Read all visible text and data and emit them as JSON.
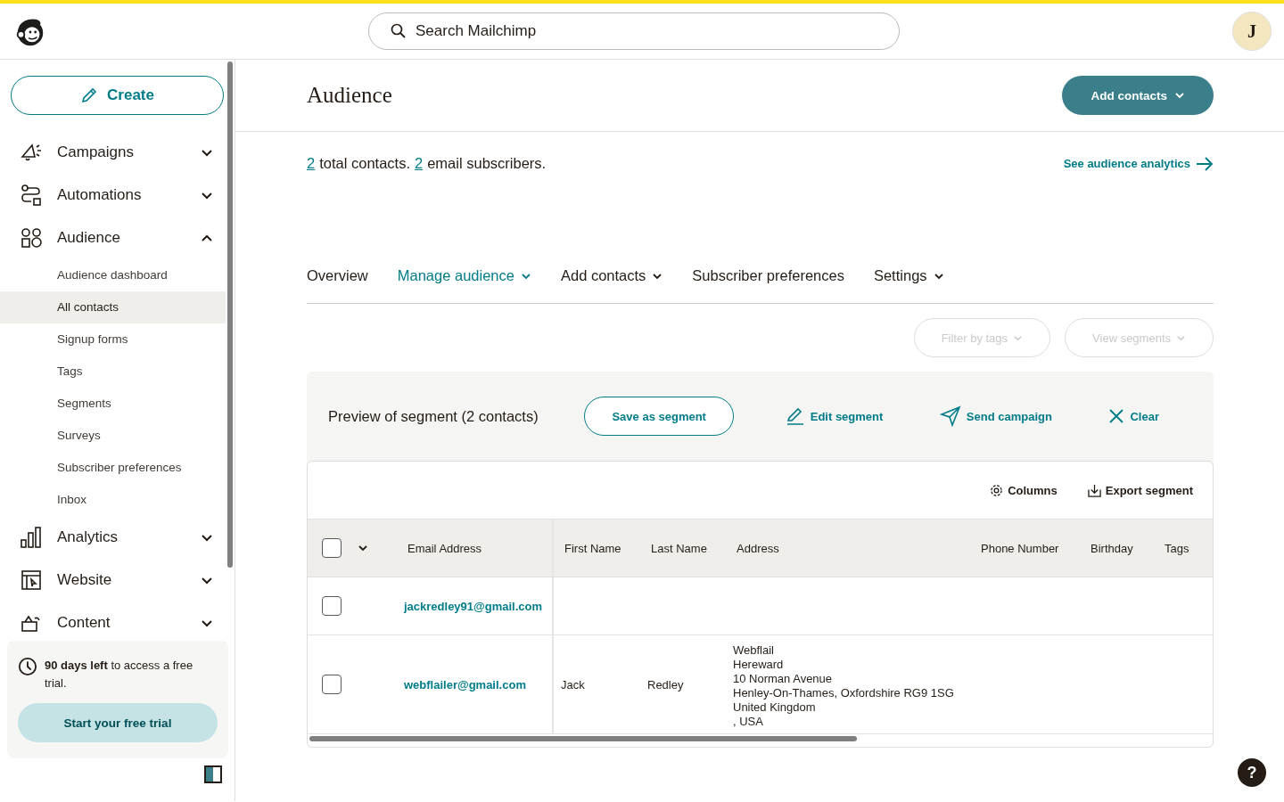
{
  "header": {
    "search_placeholder": "Search Mailchimp",
    "avatar_initial": "J"
  },
  "sidebar": {
    "create_button": "Create",
    "sections": [
      {
        "label": "Campaigns",
        "expanded": false
      },
      {
        "label": "Automations",
        "expanded": false
      },
      {
        "label": "Audience",
        "expanded": true,
        "children": [
          {
            "label": "Audience dashboard",
            "selected": false
          },
          {
            "label": "All contacts",
            "selected": true
          },
          {
            "label": "Signup forms",
            "selected": false
          },
          {
            "label": "Tags",
            "selected": false
          },
          {
            "label": "Segments",
            "selected": false
          },
          {
            "label": "Surveys",
            "selected": false
          },
          {
            "label": "Subscriber preferences",
            "selected": false
          },
          {
            "label": "Inbox",
            "selected": false
          }
        ]
      },
      {
        "label": "Analytics",
        "expanded": false
      },
      {
        "label": "Website",
        "expanded": false
      },
      {
        "label": "Content",
        "expanded": false
      }
    ],
    "trial": {
      "text": "**90 days left** to access a free trial.",
      "button": "Start your free trial"
    }
  },
  "page": {
    "title": "Audience",
    "add_contacts_button": "Add contacts",
    "summary": {
      "total_count": "2",
      "total_label": "total contacts.",
      "subscriber_count": "2",
      "subscriber_label": "email subscribers."
    },
    "analytics_link": "See audience analytics",
    "tabs": [
      {
        "label": "Overview",
        "selected": false,
        "dropdown": false
      },
      {
        "label": "Manage audience",
        "selected": true,
        "dropdown": true
      },
      {
        "label": "Add contacts",
        "selected": false,
        "dropdown": true
      },
      {
        "label": "Subscriber preferences",
        "selected": false,
        "dropdown": false
      },
      {
        "label": "Settings",
        "selected": false,
        "dropdown": true
      }
    ],
    "filters": [
      {
        "label": "Filter by tags",
        "disabled": true
      },
      {
        "label": "View segments",
        "disabled": true
      }
    ],
    "segment": {
      "title": "Preview of segment (2 contacts)",
      "actions": [
        {
          "label": "Save as segment",
          "kind": "outline"
        },
        {
          "label": "Edit segment",
          "kind": "edit"
        },
        {
          "label": "Send campaign",
          "kind": "send"
        },
        {
          "label": "Clear",
          "kind": "clear"
        }
      ]
    },
    "table_tools": [
      {
        "label": "Columns",
        "kind": "columns"
      },
      {
        "label": "Export segment",
        "kind": "export"
      }
    ],
    "table": {
      "select_all_checked": false,
      "columns": [
        "Email Address",
        "First Name",
        "Last Name",
        "Address",
        "Phone Number",
        "Birthday",
        "Tags"
      ],
      "rows": [
        {
          "checked": false,
          "email": "jackredley91@gmail.com"
        },
        {
          "checked": false,
          "email": "webflailer@gmail.com",
          "first_name": "Jack",
          "last_name": "Redley",
          "address": [
            "Webflail",
            "Hereward",
            "10 Norman Avenue",
            "Henley-On-Thames, Oxfordshire RG9 1SG",
            "United Kingdom",
            ", USA"
          ]
        }
      ]
    }
  },
  "help_button": "?"
}
